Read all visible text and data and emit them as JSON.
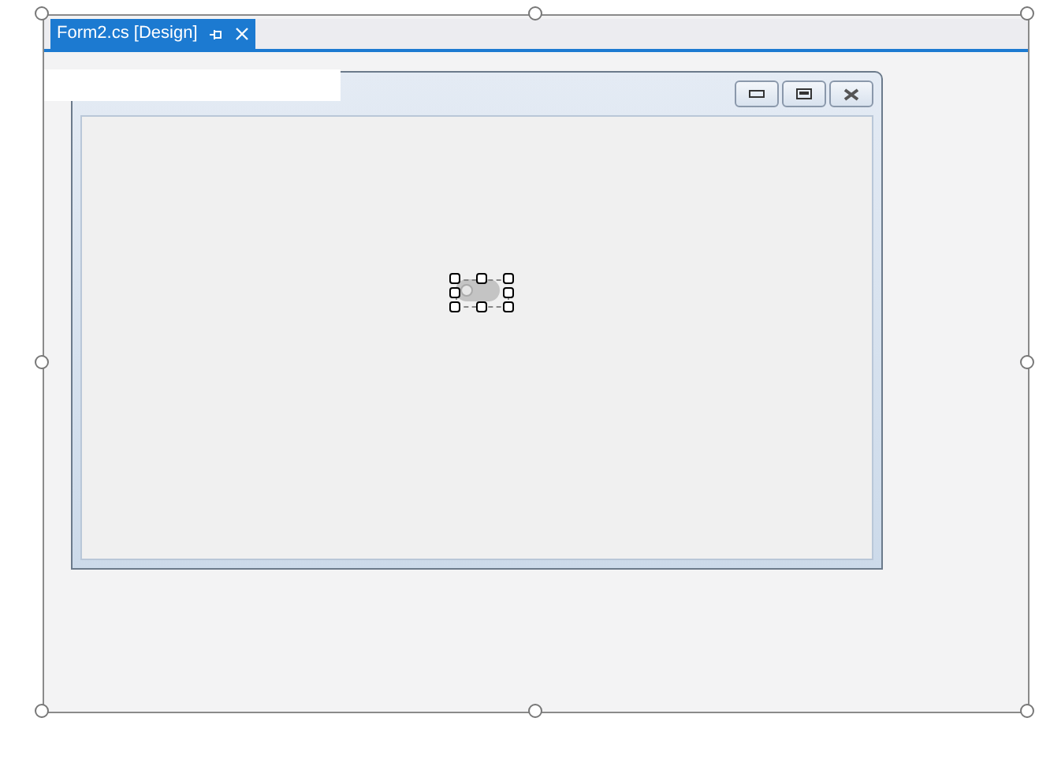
{
  "tabs": [
    {
      "label": "Form2.cs [Design]",
      "selected": true
    }
  ],
  "form": {
    "control": {
      "kind": "toggle",
      "selected": true
    }
  }
}
